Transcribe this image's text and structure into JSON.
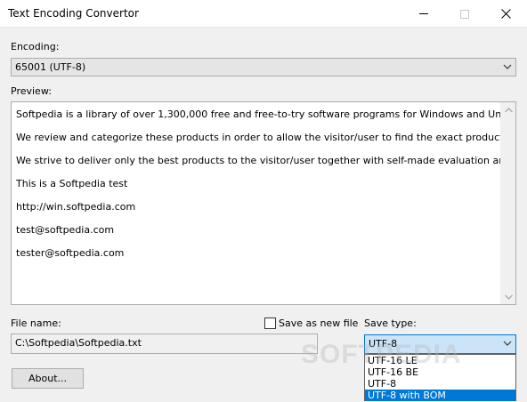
{
  "window": {
    "title": "Text Encoding Convertor"
  },
  "encoding": {
    "label": "Encoding:",
    "selected": "65001 (UTF-8)"
  },
  "preview": {
    "label": "Preview:",
    "lines": [
      "Softpedia is a library of over 1,300,000 free and free-to-try software programs for Windows and Unix/Linux, gar",
      "We review and categorize these products in order to allow the visitor/user to find the exact product they and the",
      "We strive to deliver only the best products to the visitor/user together with self-made evaluation and review not",
      "This is a Softpedia test",
      "http://win.softpedia.com",
      "test@softpedia.com",
      "tester@softpedia.com"
    ]
  },
  "file_name": {
    "label": "File name:",
    "value": "C:\\Softpedia\\Softpedia.txt"
  },
  "save_as_new_file": {
    "label": "Save as new file",
    "checked": false
  },
  "save_type": {
    "label": "Save type:",
    "selected": "UTF-8",
    "options": [
      "UTF-16 LE",
      "UTF-16 BE",
      "UTF-8",
      "UTF-8 with BOM"
    ],
    "highlighted_index": 3
  },
  "about_button": {
    "label": "About..."
  },
  "watermark": "SOFTPEDIA",
  "colors": {
    "selection": "#0078d7",
    "window_bg": "#f0f0f0"
  }
}
